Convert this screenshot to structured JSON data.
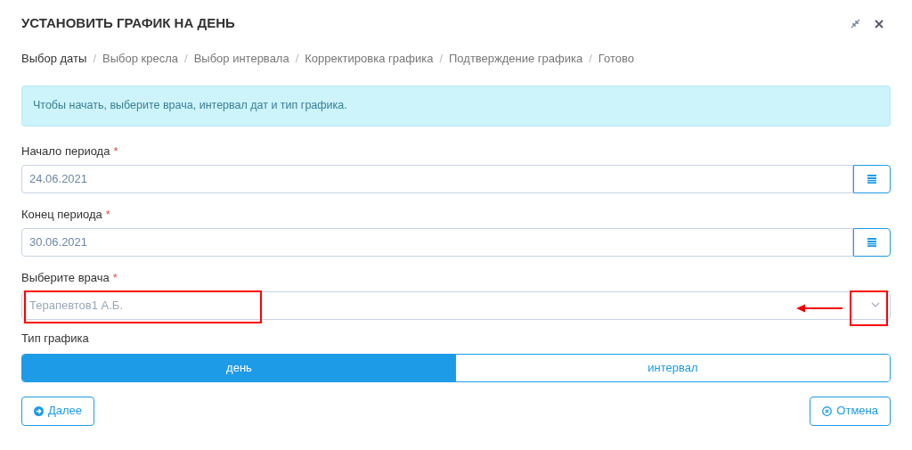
{
  "dialog": {
    "title": "УСТАНОВИТЬ ГРАФИК НА ДЕНЬ"
  },
  "steps": [
    {
      "label": "Выбор даты",
      "selected": true
    },
    {
      "separator": "/",
      "label": "Выбор кресла",
      "selected": false
    },
    {
      "separator": "/",
      "label": "Выбор интервала",
      "selected": false
    },
    {
      "separator": "/",
      "label": "Корректировка графика",
      "selected": false
    },
    {
      "separator": "/",
      "label": "Подтверждение графика",
      "selected": false
    },
    {
      "separator": "/",
      "label": "Готово",
      "selected": false
    }
  ],
  "alert": "Чтобы начать, выберите врача, интервал дат и тип графика.",
  "fields": [
    {
      "kind": "date",
      "label": "Начало периода",
      "required_mark": "*",
      "value": "24.06.2021"
    },
    {
      "kind": "date",
      "label": "Конец периода",
      "required_mark": "*",
      "value": "30.06.2021"
    },
    {
      "kind": "select",
      "label": "Выберите врача",
      "required_mark": "*",
      "value": "Терапевтов1 А.Б."
    }
  ],
  "schedule_type": {
    "label": "Тип графика",
    "options": [
      {
        "label": "день",
        "selected": true
      },
      {
        "label": "интервал",
        "selected": false
      }
    ]
  },
  "buttons": [
    {
      "kind": "next",
      "label": "Далее"
    },
    {
      "kind": "cancel",
      "label": "Отмена"
    }
  ]
}
